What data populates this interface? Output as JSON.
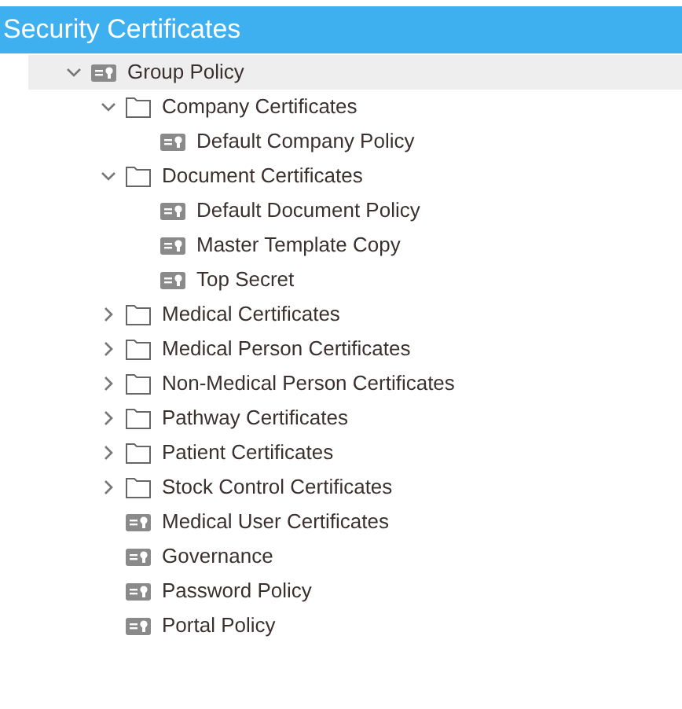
{
  "panel": {
    "title": "Security Certificates"
  },
  "tree": [
    {
      "label": "Group Policy",
      "kind": "certificate",
      "expanded": true,
      "selected": true,
      "children": [
        {
          "label": "Company Certificates",
          "kind": "folder",
          "expanded": true,
          "selected": false,
          "children": [
            {
              "label": "Default Company Policy",
              "kind": "certificate",
              "selected": false
            }
          ]
        },
        {
          "label": "Document Certificates",
          "kind": "folder",
          "expanded": true,
          "selected": false,
          "children": [
            {
              "label": "Default Document Policy",
              "kind": "certificate",
              "selected": false
            },
            {
              "label": "Master Template Copy",
              "kind": "certificate",
              "selected": false
            },
            {
              "label": "Top Secret",
              "kind": "certificate",
              "selected": false
            }
          ]
        },
        {
          "label": "Medical Certificates",
          "kind": "folder",
          "expanded": false,
          "selected": false
        },
        {
          "label": "Medical Person Certificates",
          "kind": "folder",
          "expanded": false,
          "selected": false
        },
        {
          "label": "Non-Medical Person Certificates",
          "kind": "folder",
          "expanded": false,
          "selected": false
        },
        {
          "label": "Pathway Certificates",
          "kind": "folder",
          "expanded": false,
          "selected": false
        },
        {
          "label": "Patient Certificates",
          "kind": "folder",
          "expanded": false,
          "selected": false
        },
        {
          "label": "Stock Control Certificates",
          "kind": "folder",
          "expanded": false,
          "selected": false
        },
        {
          "label": "Medical User Certificates",
          "kind": "certificate",
          "selected": false
        },
        {
          "label": "Governance",
          "kind": "certificate",
          "selected": false
        },
        {
          "label": "Password Policy",
          "kind": "certificate",
          "selected": false
        },
        {
          "label": "Portal Policy",
          "kind": "certificate",
          "selected": false
        }
      ]
    }
  ]
}
